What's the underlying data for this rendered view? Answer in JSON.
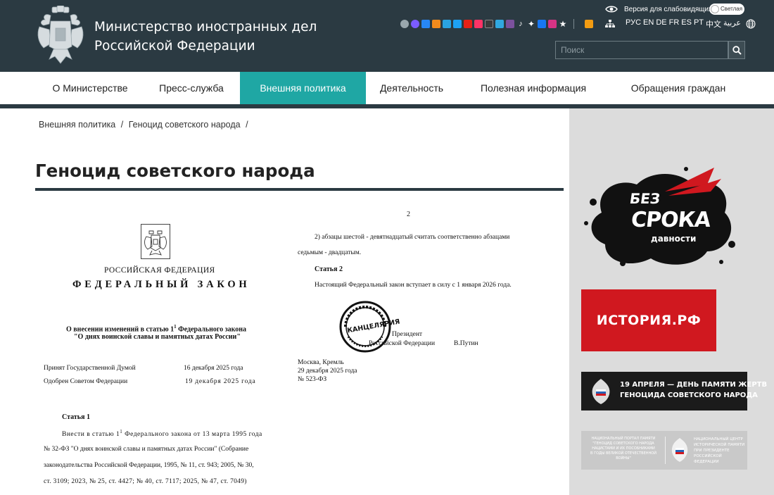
{
  "header": {
    "title_line1": "Министерство иностранных дел",
    "title_line2": "Российской Федерации",
    "vision_label": "Версия для слабовидящих",
    "toggle_label": "Светлая",
    "languages": [
      "РУС",
      "EN",
      "DE",
      "FR",
      "ES",
      "PT",
      "中文",
      "عربية"
    ],
    "search_placeholder": "Поиск",
    "social_icons": [
      "share-icon",
      "max-icon",
      "vk-icon",
      "ok-icon",
      "telegram-icon",
      "twitter-icon",
      "youtube-icon",
      "rutube-icon",
      "dzen-icon",
      "telegram-2-icon",
      "viber-icon",
      "tiktok-icon",
      "livejournal-icon",
      "facebook-icon",
      "instagram-icon",
      "star-icon"
    ],
    "colors": {
      "header_bg": "#2b3a42",
      "accent": "#1fa7a4"
    }
  },
  "nav": {
    "items": [
      {
        "label": "О Министерстве"
      },
      {
        "label": "Пресс-служба"
      },
      {
        "label": "Внешняя политика",
        "active": true
      },
      {
        "label": "Деятельность"
      },
      {
        "label": "Полезная информация"
      },
      {
        "label": "Обращения граждан"
      }
    ]
  },
  "breadcrumb": {
    "items": [
      "Внешняя политика",
      "Геноцид советского народа"
    ],
    "separator": "/"
  },
  "page": {
    "title": "Геноцид советского народа"
  },
  "document": {
    "left": {
      "country": "РОССИЙСКАЯ ФЕДЕРАЦИЯ",
      "law_type": "ФЕДЕРАЛЬНЫЙ ЗАКОН",
      "subject_line1": "О внесении изменений в статью 1",
      "subject_sup": "1",
      "subject_line1_end": " Федерального закона",
      "subject_line2": "\"О днях воинской славы и памятных датах России\"",
      "adopted_label": "Принят Государственной Думой",
      "adopted_date": "16 декабря 2025 года",
      "approved_label": "Одобрен Советом Федерации",
      "approved_date": "19 декабря 2025 года",
      "article1_title": "Статья 1",
      "article1_line1_a": "Внести в статью 1",
      "article1_line1_sup": "1",
      "article1_line1_b": " Федерального закона от 13 марта 1995 года",
      "article1_line2": "№ 32-ФЗ \"О днях воинской славы и памятных датах России\" (Собрание",
      "article1_line3": "законодательства Российской Федерации, 1995, № 11, ст. 943; 2005, № 30,",
      "article1_line4": "ст. 3109; 2023, № 25, ст. 4427; № 40, ст. 7117; 2025, № 47, ст. 7049)"
    },
    "right": {
      "page_number": "2",
      "para_line1": "2) абзацы шестой - девятнадцатый считать соответственно абзацами",
      "para_line2": "седьмым - двадцатым.",
      "article2_title": "Статья 2",
      "article2_text": "Настоящий Федеральный закон вступает в силу с 1 января 2026 года.",
      "signature_role_line1": "Президент",
      "signature_role_line2": "Российской Федерации",
      "signature_name": "В.Путин",
      "stamp_text": "КАНЦЕЛЯРИЯ",
      "place": "Москва, Кремль",
      "date": "29 декабря 2025 года",
      "number": "№ 523-ФЗ"
    }
  },
  "sidebar": {
    "banner1": {
      "line1": "БЕЗ",
      "line2": "СРОКА",
      "line3": "давности"
    },
    "banner2": {
      "text": "ИСТОРИЯ.РФ",
      "color": "#d0181f"
    },
    "banner3": {
      "line1": "19 АПРЕЛЯ — ДЕНЬ ПАМЯТИ ЖЕРТВ",
      "line2": "ГЕНОЦИДА СОВЕТСКОГО НАРОДА"
    },
    "banner4": {
      "left_lines": [
        "НАЦИОНАЛЬНЫЙ ПОРТАЛ ПАМЯТИ",
        "\"ГЕНОЦИД СОВЕТСКОГО НАРОДА",
        "НАЦИСТАМИ И ИХ ПОСОБНИКАМИ",
        "В ГОДЫ ВЕЛИКОЙ ОТЕЧЕСТВЕННОЙ ВОЙНЫ\""
      ],
      "right_lines": [
        "НАЦИОНАЛЬНЫЙ ЦЕНТР",
        "ИСТОРИЧЕСКОЙ ПАМЯТИ",
        "ПРИ ПРЕЗИДЕНТЕ",
        "РОССИЙСКОЙ ФЕДЕРАЦИИ"
      ]
    }
  }
}
